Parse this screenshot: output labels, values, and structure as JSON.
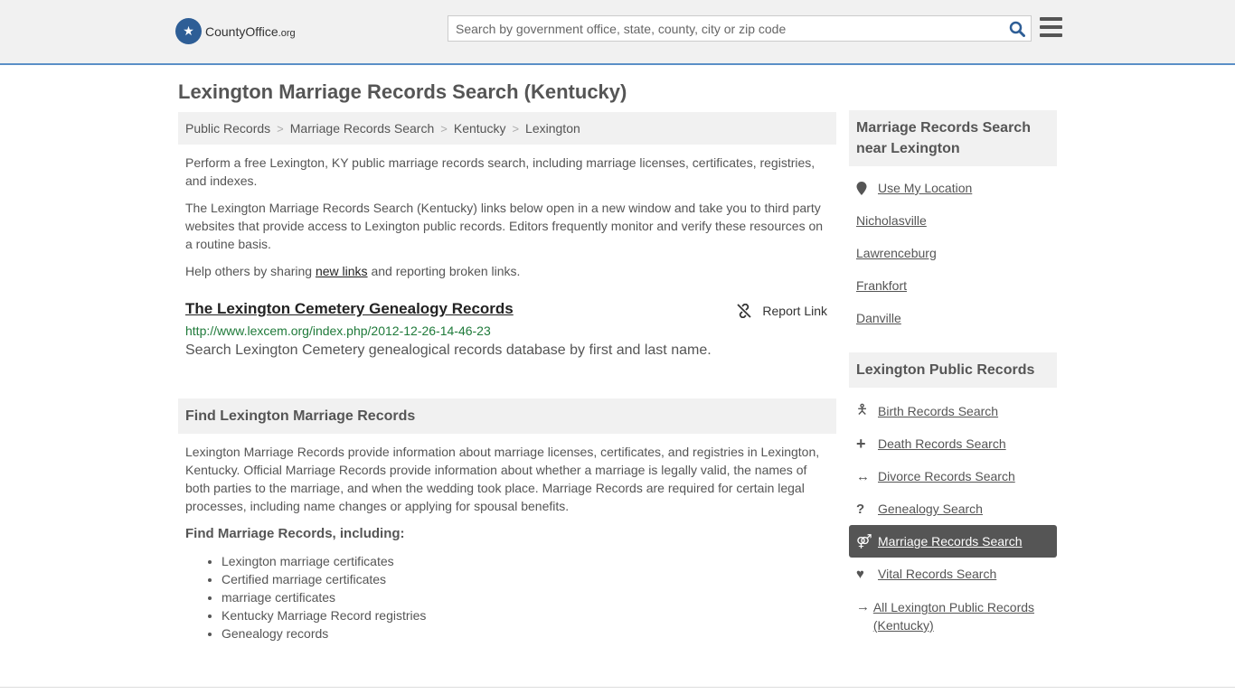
{
  "header": {
    "logo_main": "CountyOffice",
    "logo_suffix": ".org",
    "search_placeholder": "Search by government office, state, county, city or zip code"
  },
  "page_title": "Lexington Marriage Records Search (Kentucky)",
  "breadcrumb": [
    {
      "label": "Public Records"
    },
    {
      "label": "Marriage Records Search"
    },
    {
      "label": "Kentucky"
    },
    {
      "label": "Lexington"
    }
  ],
  "intro": {
    "p1": "Perform a free Lexington, KY public marriage records search, including marriage licenses, certificates, registries, and indexes.",
    "p2": "The Lexington Marriage Records Search (Kentucky) links below open in a new window and take you to third party websites that provide access to Lexington public records. Editors frequently monitor and verify these resources on a routine basis.",
    "p3_before": "Help others by sharing ",
    "p3_link": "new links",
    "p3_after": " and reporting broken links."
  },
  "result": {
    "title": "The Lexington Cemetery Genealogy Records",
    "report_label": "Report Link",
    "url": "http://www.lexcem.org/index.php/2012-12-26-14-46-23",
    "description": "Search Lexington Cemetery genealogical records database by first and last name."
  },
  "find_section": {
    "heading": "Find Lexington Marriage Records",
    "body": "Lexington Marriage Records provide information about marriage licenses, certificates, and registries in Lexington, Kentucky. Official Marriage Records provide information about whether a marriage is legally valid, the names of both parties to the marriage, and when the wedding took place. Marriage Records are required for certain legal processes, including name changes or applying for spousal benefits.",
    "subheading": "Find Marriage Records, including:",
    "items": [
      "Lexington marriage certificates",
      "Certified marriage certificates",
      "marriage certificates",
      "Kentucky Marriage Record registries",
      "Genealogy records"
    ]
  },
  "sidebar": {
    "nearby_heading": "Marriage Records Search near Lexington",
    "use_location": "Use My Location",
    "nearby": [
      "Nicholasville",
      "Lawrenceburg",
      "Frankfort",
      "Danville"
    ],
    "public_heading": "Lexington Public Records",
    "public_links": [
      {
        "label": "Birth Records Search",
        "icon": "child-icon"
      },
      {
        "label": "Death Records Search",
        "icon": "cross-icon"
      },
      {
        "label": "Divorce Records Search",
        "icon": "arrows-icon"
      },
      {
        "label": "Genealogy Search",
        "icon": "question-icon"
      },
      {
        "label": "Marriage Records Search",
        "icon": "venus-mars-icon",
        "active": true
      },
      {
        "label": "Vital Records Search",
        "icon": "heartbeat-icon"
      }
    ],
    "all_records": "All Lexington Public Records (Kentucky)"
  }
}
